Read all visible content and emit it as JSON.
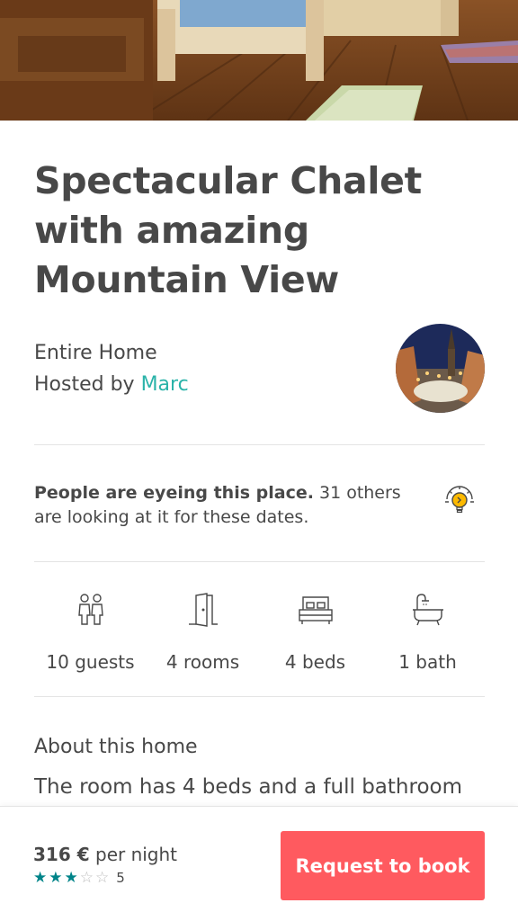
{
  "listing": {
    "title": "Spectacular Chalet with amazing Mountain View",
    "home_type": "Entire Home",
    "hosted_by_prefix": "Hosted by ",
    "host_name": "Marc"
  },
  "demand": {
    "headline": "People are eyeing this place.",
    "detail": " 31 others are looking at it for these dates.",
    "icon": "lightbulb-icon"
  },
  "amenities": [
    {
      "label": "10 guests",
      "icon": "guests-icon"
    },
    {
      "label": "4 rooms",
      "icon": "door-icon"
    },
    {
      "label": "4 beds",
      "icon": "bed-icon"
    },
    {
      "label": "1 bath",
      "icon": "bathtub-icon"
    }
  ],
  "about": {
    "title": "About this home",
    "text": "The room has 4 beds and a full bathroom"
  },
  "booking": {
    "price": "316 €",
    "price_unit": " per night",
    "rating": 3,
    "rating_max": 5,
    "review_count": "5",
    "button_label": "Request to book"
  },
  "colors": {
    "accent": "#ff5a5f",
    "link": "#2ab3a9",
    "star_filled": "#008489",
    "star_empty": "#bdbdbd"
  }
}
